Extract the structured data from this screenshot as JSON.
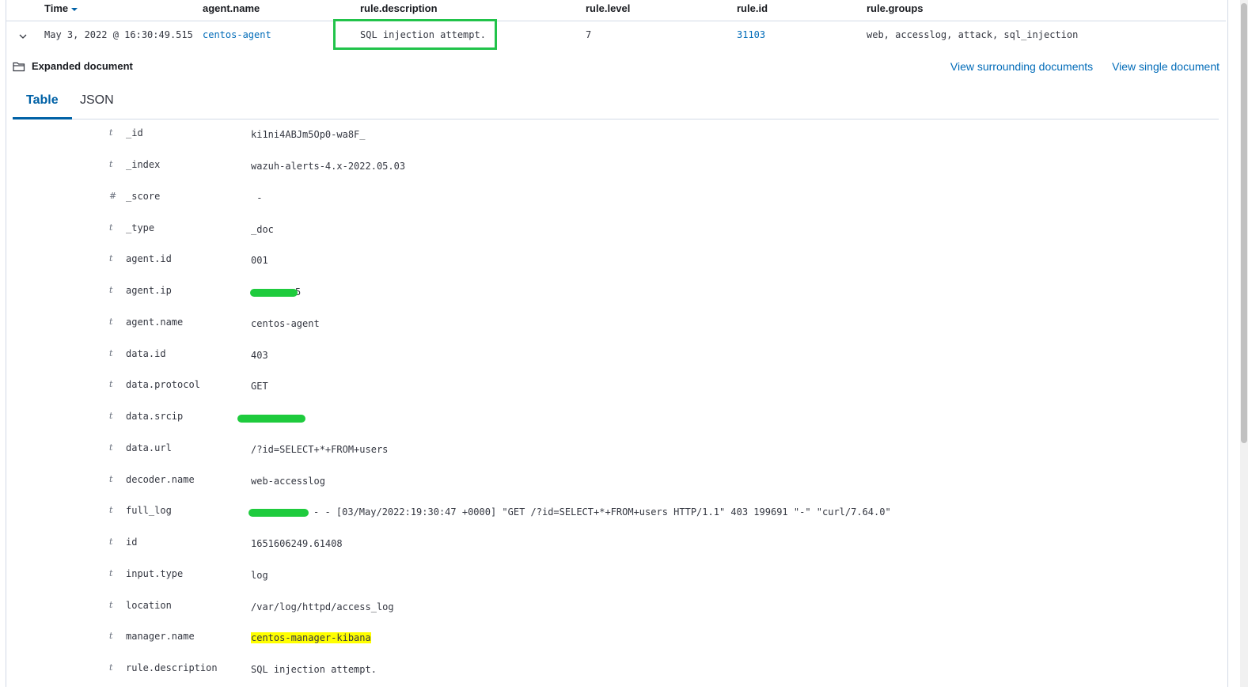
{
  "table": {
    "columns": [
      "Time",
      "agent.name",
      "rule.description",
      "rule.level",
      "rule.id",
      "rule.groups"
    ],
    "row": {
      "time": "May 3, 2022 @ 16:30:49.515",
      "agent_name": "centos-agent",
      "rule_description": "SQL injection attempt.",
      "rule_level": "7",
      "rule_id": "31103",
      "rule_groups": "web, accesslog, attack, sql_injection"
    }
  },
  "expanded": {
    "title": "Expanded document",
    "view_surrounding": "View surrounding documents",
    "view_single": "View single document",
    "tabs": [
      "Table",
      "JSON"
    ]
  },
  "fields": [
    {
      "type": "t",
      "name": "_id",
      "value": "ki1ni4ABJm5Op0-wa8F_"
    },
    {
      "type": "t",
      "name": "_index",
      "value": "wazuh-alerts-4.x-2022.05.03"
    },
    {
      "type": "#",
      "name": "_score",
      "value": " -"
    },
    {
      "type": "t",
      "name": "_type",
      "value": "_doc"
    },
    {
      "type": "t",
      "name": "agent.id",
      "value": "001"
    },
    {
      "type": "t",
      "name": "agent.ip",
      "value": "5"
    },
    {
      "type": "t",
      "name": "agent.name",
      "value": "centos-agent"
    },
    {
      "type": "t",
      "name": "data.id",
      "value": "403"
    },
    {
      "type": "t",
      "name": "data.protocol",
      "value": "GET"
    },
    {
      "type": "t",
      "name": "data.srcip",
      "value": ""
    },
    {
      "type": "t",
      "name": "data.url",
      "value": "/?id=SELECT+*+FROM+users"
    },
    {
      "type": "t",
      "name": "decoder.name",
      "value": "web-accesslog"
    },
    {
      "type": "t",
      "name": "full_log",
      "value": "- - [03/May/2022:19:30:47 +0000] \"GET /?id=SELECT+*+FROM+users HTTP/1.1\" 403 199691 \"-\" \"curl/7.64.0\""
    },
    {
      "type": "t",
      "name": "id",
      "value": "1651606249.61408"
    },
    {
      "type": "t",
      "name": "input.type",
      "value": "log"
    },
    {
      "type": "t",
      "name": "location",
      "value": "/var/log/httpd/access_log"
    },
    {
      "type": "t",
      "name": "manager.name",
      "value": "centos-manager-kibana"
    },
    {
      "type": "t",
      "name": "rule.description",
      "value": "SQL injection attempt."
    }
  ],
  "colors": {
    "link": "#006bb8",
    "highlight_box": "#21c34a",
    "redaction": "#1ecb3d",
    "mark": "#ffff00"
  }
}
